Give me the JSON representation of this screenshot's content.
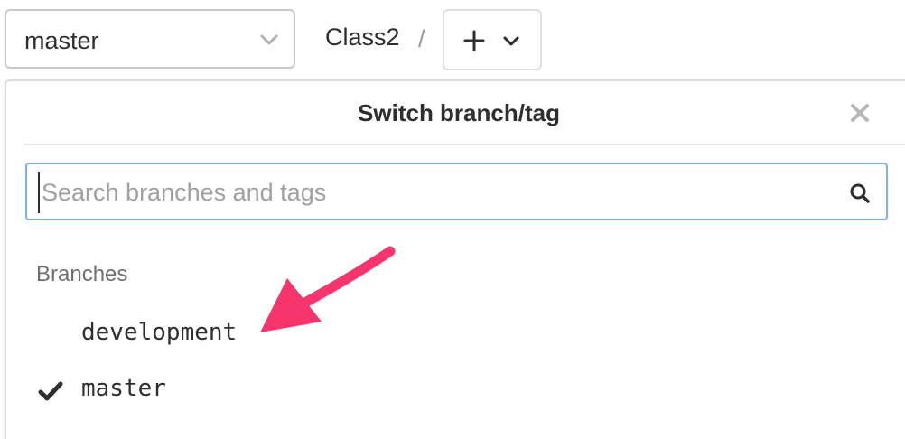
{
  "branch_selector": {
    "value": "master",
    "icon": "chevron-down-icon"
  },
  "breadcrumb": {
    "project": "Class2",
    "separator": "/"
  },
  "add_button": {
    "plus_icon": "plus-icon",
    "chevron_icon": "chevron-down-icon"
  },
  "dropdown": {
    "title": "Switch branch/tag",
    "close_icon": "close-icon",
    "search": {
      "placeholder": "Search branches and tags",
      "value": "",
      "icon": "search-icon"
    },
    "section_header": "Branches",
    "branches": [
      {
        "name": "development",
        "selected": false
      },
      {
        "name": "master",
        "selected": true
      }
    ]
  },
  "annotation": {
    "arrow_color": "#f5356b",
    "focus_color": "#7fb0e6"
  }
}
